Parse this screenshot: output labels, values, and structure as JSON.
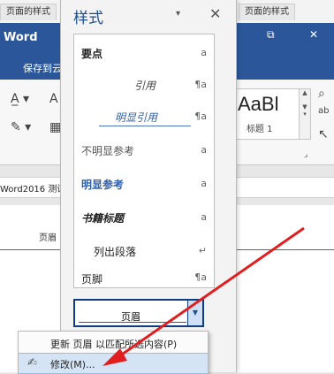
{
  "word": {
    "app_name": "Word",
    "save_tab": "保存到云",
    "doc_title": "Word2016 测试",
    "header_text": "页眉",
    "gallery_sample": "AaBl",
    "gallery_caption": "标题 1",
    "top_tab_left": "页面的样式",
    "top_tab_right": "页面的样式"
  },
  "styles_pane": {
    "title": "样式",
    "dropdown_icon": "▾",
    "close_icon": "✕",
    "items": [
      {
        "label": "要点",
        "mark": "a"
      },
      {
        "label": "引用",
        "mark": "¶a"
      },
      {
        "label": "明显引用",
        "mark": "¶a"
      },
      {
        "label": "不明显参考",
        "mark": "a"
      },
      {
        "label": "明显参考",
        "mark": "a"
      },
      {
        "label": "书籍标题",
        "mark": "a"
      },
      {
        "label": "列出段落",
        "mark": "↵"
      },
      {
        "label": "页脚",
        "mark": "¶a"
      }
    ],
    "selected_style": "页眉"
  },
  "context_menu": {
    "items": [
      {
        "label": "更新 页眉 以匹配所选内容(P)"
      },
      {
        "label": "修改(M)..."
      }
    ]
  },
  "colors": {
    "accent": "#2b579a",
    "pane_title": "#1e4e8c",
    "arrow": "#e02020"
  }
}
